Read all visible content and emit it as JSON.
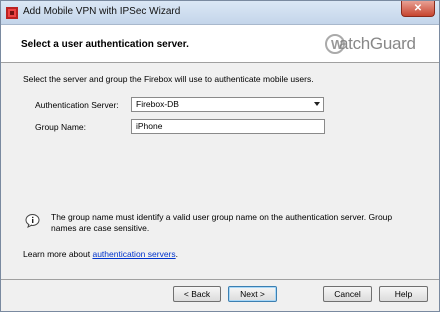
{
  "window": {
    "title": "Add Mobile VPN with IPSec Wizard",
    "close_glyph": "✕"
  },
  "header": {
    "title": "Select a user authentication server.",
    "logo_text": "atchGuard",
    "logo_letter": "W"
  },
  "form": {
    "description": "Select the server and group the Firebox will use to authenticate mobile users.",
    "auth_server_label": "Authentication Server:",
    "auth_server_value": "Firebox-DB",
    "group_name_label": "Group Name:",
    "group_name_value": "iPhone"
  },
  "info": {
    "text": "The group name must identify a valid user group name on the authentication server. Group names are case sensitive."
  },
  "help_link": {
    "prefix": "Learn more about ",
    "link_text": "authentication servers",
    "suffix": "."
  },
  "buttons": {
    "back": "< Back",
    "next": "Next >",
    "cancel": "Cancel",
    "help": "Help"
  },
  "colors": {
    "link": "#0033cc",
    "close_button": "#c7452f",
    "titlebar": "#c4d5ea"
  }
}
